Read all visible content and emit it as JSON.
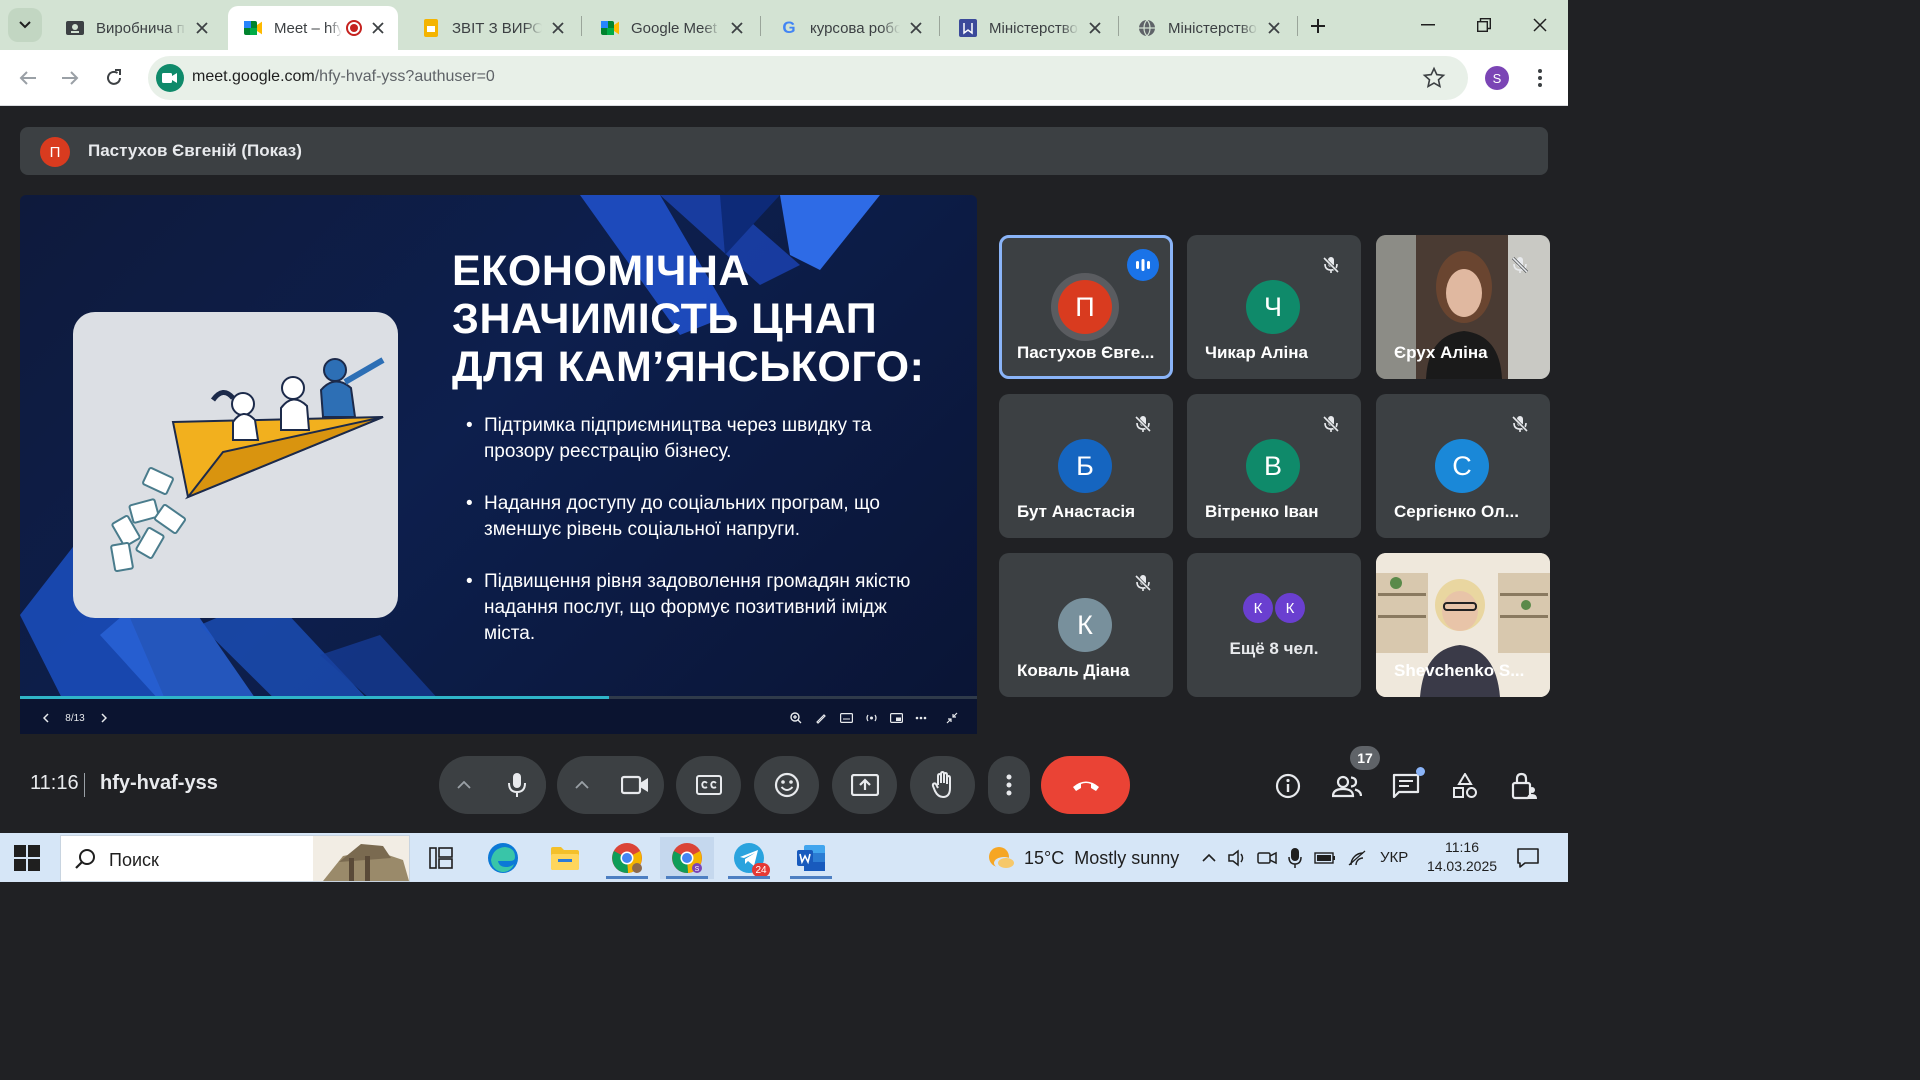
{
  "browser": {
    "tabs": [
      {
        "title": "Виробнича п",
        "favicon": "classroom-icon",
        "active": false
      },
      {
        "title": "Meet – hfy",
        "favicon": "meet-icon",
        "active": true,
        "recording": true
      },
      {
        "title": "ЗВІТ З ВИРОБ",
        "favicon": "slides-icon",
        "active": false
      },
      {
        "title": "Google Meet",
        "favicon": "meet-icon",
        "active": false
      },
      {
        "title": "курсова робо",
        "favicon": "google-icon",
        "active": false
      },
      {
        "title": "Міністерство",
        "favicon": "ministry-icon",
        "active": false
      },
      {
        "title": "Міністерство",
        "favicon": "globe-icon",
        "active": false
      }
    ],
    "url_host": "meet.google.com",
    "url_path": "/hfy-hvaf-yss?authuser=0",
    "profile_initial": "S"
  },
  "meet": {
    "presenter": {
      "initial": "П",
      "label": "Пастухов Євгеній (Показ)"
    },
    "slide": {
      "title_lines": [
        "ЕКОНОМІЧНА",
        "ЗНАЧИМІСТЬ ЦНАП",
        "ДЛЯ КАМ’ЯНСЬКОГО:"
      ],
      "bullets": [
        "Підтримка підприємництва через швидку та прозору реєстрацію бізнесу.",
        "Надання доступу до соціальних програм, що зменшує рівень соціальної напруги.",
        "Підвищення рівня задоволення громадян якістю надання послуг, що формує позитивний імідж міста."
      ],
      "page_indicator": "8/13",
      "progress_fraction": 0.615
    },
    "participants": [
      {
        "name": "Пастухов Євге...",
        "initial": "П",
        "color": "#d93b1f",
        "speaking": true,
        "muted": false
      },
      {
        "name": "Чикар Аліна",
        "initial": "Ч",
        "color": "#0f8a6a",
        "speaking": false,
        "muted": true
      },
      {
        "name": "Єрух Аліна",
        "initial": "",
        "color": "#5a4a40",
        "video": true,
        "muted": true
      },
      {
        "name": "Бут Анастасія",
        "initial": "Б",
        "color": "#1565c0",
        "speaking": false,
        "muted": true
      },
      {
        "name": "Вітренко Іван",
        "initial": "В",
        "color": "#0f8a6a",
        "speaking": false,
        "muted": true
      },
      {
        "name": "Сергієнко Ол...",
        "initial": "С",
        "color": "#1a88d8",
        "speaking": false,
        "muted": true
      },
      {
        "name": "Коваль Діана",
        "initial": "К",
        "color": "#78909c",
        "speaking": false,
        "muted": true
      },
      {
        "name": "Shevchenko S...",
        "initial": "",
        "color": "#b8a890",
        "video": true,
        "muted": false
      }
    ],
    "more": {
      "initials": [
        "К",
        "К"
      ],
      "label": "Ещё 8 чел."
    },
    "time": "11:16",
    "code": "hfy-hvaf-yss",
    "participants_count": "17"
  },
  "taskbar": {
    "search_label": "Поиск",
    "weather_temp": "15°C",
    "weather_text": "Mostly sunny",
    "language": "УКР",
    "clock_time": "11:16",
    "clock_date": "14.03.2025",
    "telegram_badge": "24"
  }
}
